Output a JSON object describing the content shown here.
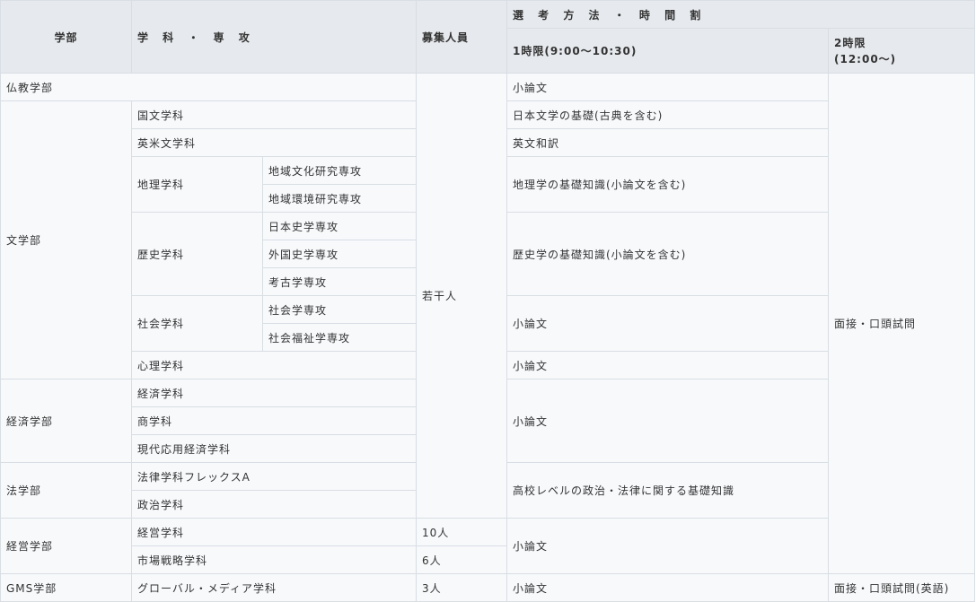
{
  "header": {
    "faculty": "学部",
    "department": "学 科 ・ 専 攻",
    "capacity": "募集人員",
    "method": "選 考 方 法 ・ 時 間 割",
    "period1": "1時限(9:00〜10:30)",
    "period2_line1": "2時限",
    "period2_line2": "(12:00〜)"
  },
  "rows": {
    "bukkyo": {
      "faculty": "仏教学部",
      "exam1": "小論文"
    },
    "bungaku": {
      "faculty": "文学部",
      "kokubun": "国文学科",
      "kokubun_exam": "日本文学の基礎(古典を含む)",
      "eibei": "英米文学科",
      "eibei_exam": "英文和訳",
      "chiri": "地理学科",
      "chiri_major1": "地域文化研究専攻",
      "chiri_major2": "地域環境研究専攻",
      "chiri_exam": "地理学の基礎知識(小論文を含む)",
      "rekishi": "歴史学科",
      "rekishi_major1": "日本史学専攻",
      "rekishi_major2": "外国史学専攻",
      "rekishi_major3": "考古学専攻",
      "rekishi_exam": "歴史学の基礎知識(小論文を含む)",
      "shakai": "社会学科",
      "shakai_major1": "社会学専攻",
      "shakai_major2": "社会福祉学専攻",
      "shakai_exam": "小論文",
      "shinri": "心理学科",
      "shinri_exam": "小論文"
    },
    "keizai": {
      "faculty": "経済学部",
      "dept1": "経済学科",
      "dept2": "商学科",
      "dept3": "現代応用経済学科",
      "exam": "小論文"
    },
    "hou": {
      "faculty": "法学部",
      "dept1": "法律学科フレックスA",
      "dept2": "政治学科",
      "exam": "高校レベルの政治・法律に関する基礎知識"
    },
    "common": {
      "capacity": "若干人",
      "exam2": "面接・口頭試問"
    },
    "keiei": {
      "faculty": "経営学部",
      "dept1": "経営学科",
      "cap1": "10人",
      "dept2": "市場戦略学科",
      "cap2": "6人",
      "exam": "小論文"
    },
    "gms": {
      "faculty": "GMS学部",
      "dept": "グローバル・メディア学科",
      "capacity": "3人",
      "exam1": "小論文",
      "exam2": "面接・口頭試問(英語)"
    }
  }
}
